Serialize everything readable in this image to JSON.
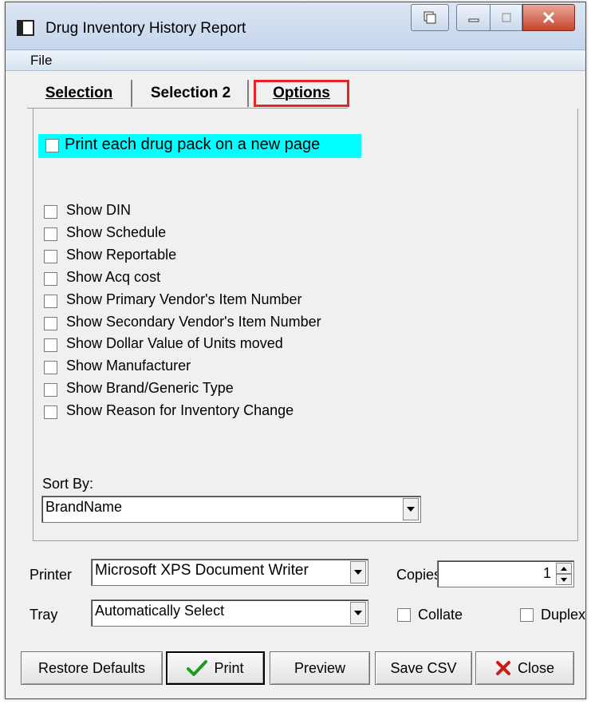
{
  "window": {
    "title": "Drug Inventory History Report"
  },
  "menu": {
    "file": "File"
  },
  "tabs": [
    {
      "label": "Selection",
      "underline": "S"
    },
    {
      "label": "Selection 2",
      "underline": "2"
    },
    {
      "label": "Options",
      "underline": "O",
      "selected": true
    }
  ],
  "options": {
    "highlight_label": "Print each drug pack on a new page",
    "highlight_checked": false,
    "items": [
      {
        "label": "Show DIN",
        "checked": false
      },
      {
        "label": "Show Schedule",
        "checked": false
      },
      {
        "label": "Show Reportable",
        "checked": false
      },
      {
        "label": "Show Acq cost",
        "checked": false
      },
      {
        "label": "Show Primary Vendor's Item Number",
        "checked": false
      },
      {
        "label": "Show Secondary Vendor's Item Number",
        "checked": false
      },
      {
        "label": "Show Dollar Value of Units moved",
        "checked": false
      },
      {
        "label": "Show Manufacturer",
        "checked": false
      },
      {
        "label": "Show Brand/Generic Type",
        "checked": false
      },
      {
        "label": "Show Reason for Inventory Change",
        "checked": false
      }
    ],
    "sort_by_label": "Sort By:",
    "sort_by_value": "BrandName"
  },
  "printer": {
    "label": "Printer",
    "value": "Microsoft XPS Document Writer",
    "copies_label": "Copies",
    "copies_value": "1",
    "tray_label": "Tray",
    "tray_value": "Automatically Select",
    "collate_label": "Collate",
    "collate_checked": false,
    "duplex_label": "Duplex",
    "duplex_checked": false
  },
  "buttons": {
    "restore_defaults": "Restore Defaults",
    "print": "Print",
    "preview": "Preview",
    "save_csv": "Save CSV",
    "close": "Close"
  },
  "colors": {
    "highlight": "#00ffff",
    "options_tab_border": "#e3252b",
    "check_green": "#1a9e1a",
    "close_x_red": "#cc1a1a"
  }
}
